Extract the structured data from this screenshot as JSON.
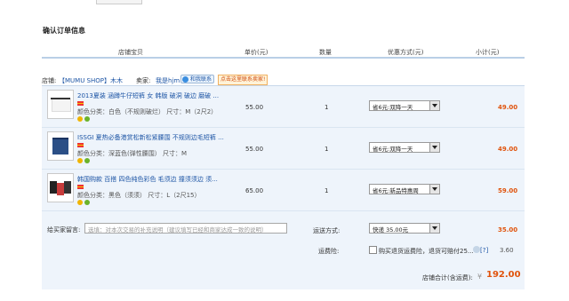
{
  "section_title": "确认订单信息",
  "headers": {
    "product": "店铺宝贝",
    "unit_price": "单价(元)",
    "quantity": "数量",
    "discount": "优惠方式(元)",
    "subtotal": "小计(元)"
  },
  "shop": {
    "label": "店铺:",
    "name": "【MUMU SHOP】木木",
    "seller_label": "卖家:",
    "seller_name": "我是hjm",
    "wangwang": "和我联系",
    "contact": "点击这里联系卖家!"
  },
  "items": [
    {
      "name": "2013夏装 涵蹲牛仔短裤 女 韩版 破洞 破边 磨破 ...",
      "attrs": "颜色分类：白色（不规则破烂） 尺寸：M（2尺2）",
      "price": "55.00",
      "qty": "1",
      "discount": "省6元:双降一天",
      "subtotal": "49.00"
    },
    {
      "name": "ISSGI 夏热必备港赏松新松紧腰围 不规则边毛短裤 ...",
      "attrs": "颜色分类：深蓝色(弹性腰围） 尺寸：M",
      "price": "55.00",
      "qty": "1",
      "discount": "省6元:双降一天",
      "subtotal": "49.00"
    },
    {
      "name": "韩国购款 百搭 四色纯色彩色 毛须边 撞须须边 须...",
      "attrs": "颜色分类：黑色（须须） 尺寸：L（2尺15）",
      "price": "65.00",
      "qty": "1",
      "discount": "省6元:新品特惠周",
      "subtotal": "59.00"
    }
  ],
  "message": {
    "label": "给买家留言:",
    "placeholder": "选填：对本次交易的补充说明（建议填写已经和商家达成一致的说明）"
  },
  "shipping": {
    "label": "运送方式:",
    "selected": "快递 35.00元",
    "amount": "35.00"
  },
  "insurance": {
    "label": "运费险:",
    "text": "购买退货运费险，退货可赔付25...",
    "help": "[?]",
    "amount": "3.60"
  },
  "total": {
    "label": "店铺合计(含运费):",
    "currency": "¥",
    "amount": "192.00"
  },
  "colors": {
    "accent": "#e0530c",
    "link": "#1d55a5",
    "box_bg": "#eef4fb"
  }
}
